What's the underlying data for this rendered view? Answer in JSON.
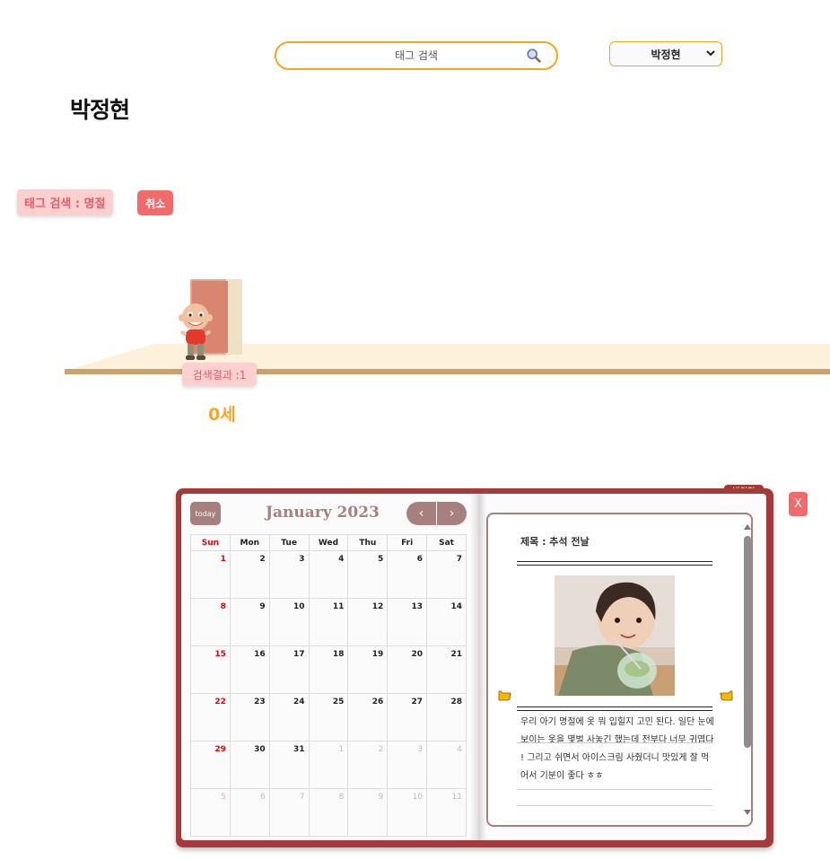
{
  "search": {
    "placeholder": "태그 검색"
  },
  "user_select": {
    "selected": "박정현"
  },
  "page_title": "박정현",
  "tag_filter": {
    "label": "태그 검색 : 명절",
    "cancel_label": "취소"
  },
  "timeline": {
    "result_label": "검색결과 :1",
    "age_label": "0세"
  },
  "diary": {
    "owner_tab": "박정현",
    "close_label": "X",
    "calendar": {
      "today_label": "today",
      "month_title": "January 2023",
      "prev_label": "‹",
      "next_label": "›",
      "weekdays": [
        "Sun",
        "Mon",
        "Tue",
        "Wed",
        "Thu",
        "Fri",
        "Sat"
      ],
      "weeks": [
        [
          "1",
          "2",
          "3",
          "4",
          "5",
          "6",
          "7"
        ],
        [
          "8",
          "9",
          "10",
          "11",
          "12",
          "13",
          "14"
        ],
        [
          "15",
          "16",
          "17",
          "18",
          "19",
          "20",
          "21"
        ],
        [
          "22",
          "23",
          "24",
          "25",
          "26",
          "27",
          "28"
        ],
        [
          "29",
          "30",
          "31",
          "1",
          "2",
          "3",
          "4"
        ],
        [
          "5",
          "6",
          "7",
          "8",
          "9",
          "10",
          "11"
        ]
      ]
    },
    "entry": {
      "title": "제목 : 추석 전날",
      "text": "우리 아기 명절에 옷 뭐 입힐지 고민 된다. 일단 눈에 보이는 옷을 몇벌 사놓긴 했는데 전부다 너무 귀엽다 ! 그리고 쉬면서 아이스크림 사줬더니 맛있게 잘 먹어서 기분이 좋다 ㅎㅎ"
    }
  },
  "colors": {
    "accent_orange": "#f5a623",
    "book_red": "#a53a3a",
    "muted_mauve": "#a87f7f",
    "chip_pink": "#fdd0d0",
    "button_red": "#f26a6a"
  }
}
